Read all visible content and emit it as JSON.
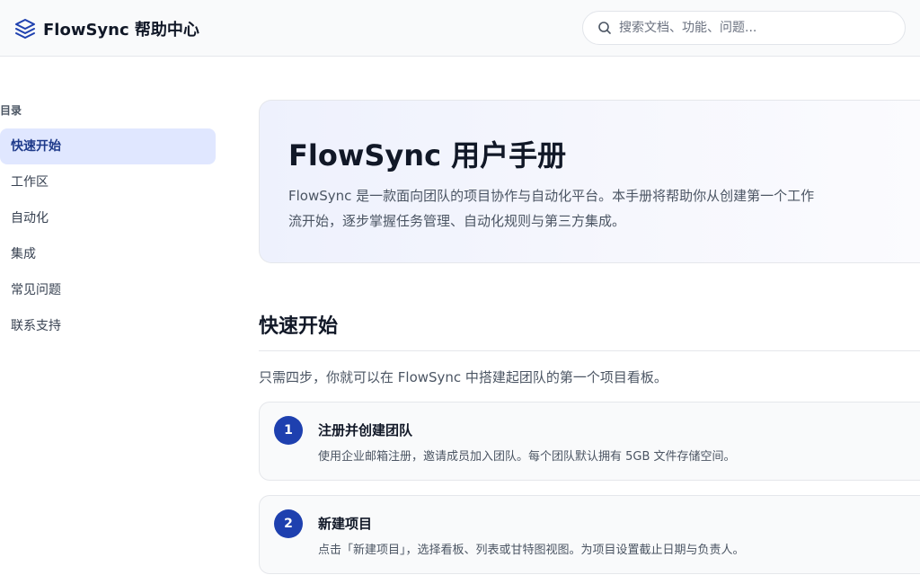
{
  "header": {
    "logo_text": "FlowSync 帮助中心",
    "search_placeholder": "搜索文档、功能、问题..."
  },
  "sidebar": {
    "title": "目录",
    "items": [
      {
        "label": "快速开始",
        "active": true
      },
      {
        "label": "工作区"
      },
      {
        "label": "自动化"
      },
      {
        "label": "集成"
      },
      {
        "label": "常见问题"
      },
      {
        "label": "联系支持"
      }
    ]
  },
  "hero": {
    "title": "FlowSync 用户手册",
    "description": "FlowSync 是一款面向团队的项目协作与自动化平台。本手册将帮助你从创建第一个工作流开始，逐步掌握任务管理、自动化规则与第三方集成。"
  },
  "section": {
    "title": "快速开始",
    "intro": "只需四步，你就可以在 FlowSync 中搭建起团队的第一个项目看板。"
  },
  "steps": [
    {
      "number": "1",
      "title": "注册并创建团队",
      "description": "使用企业邮箱注册，邀请成员加入团队。每个团队默认拥有 5GB 文件存储空间。"
    },
    {
      "number": "2",
      "title": "新建项目",
      "description": "点击「新建项目」，选择看板、列表或甘特图视图。为项目设置截止日期与负责人。"
    }
  ],
  "colors": {
    "accent": "#1e40af",
    "active_bg": "#e0e7ff",
    "active_text": "#1e3a8a"
  }
}
